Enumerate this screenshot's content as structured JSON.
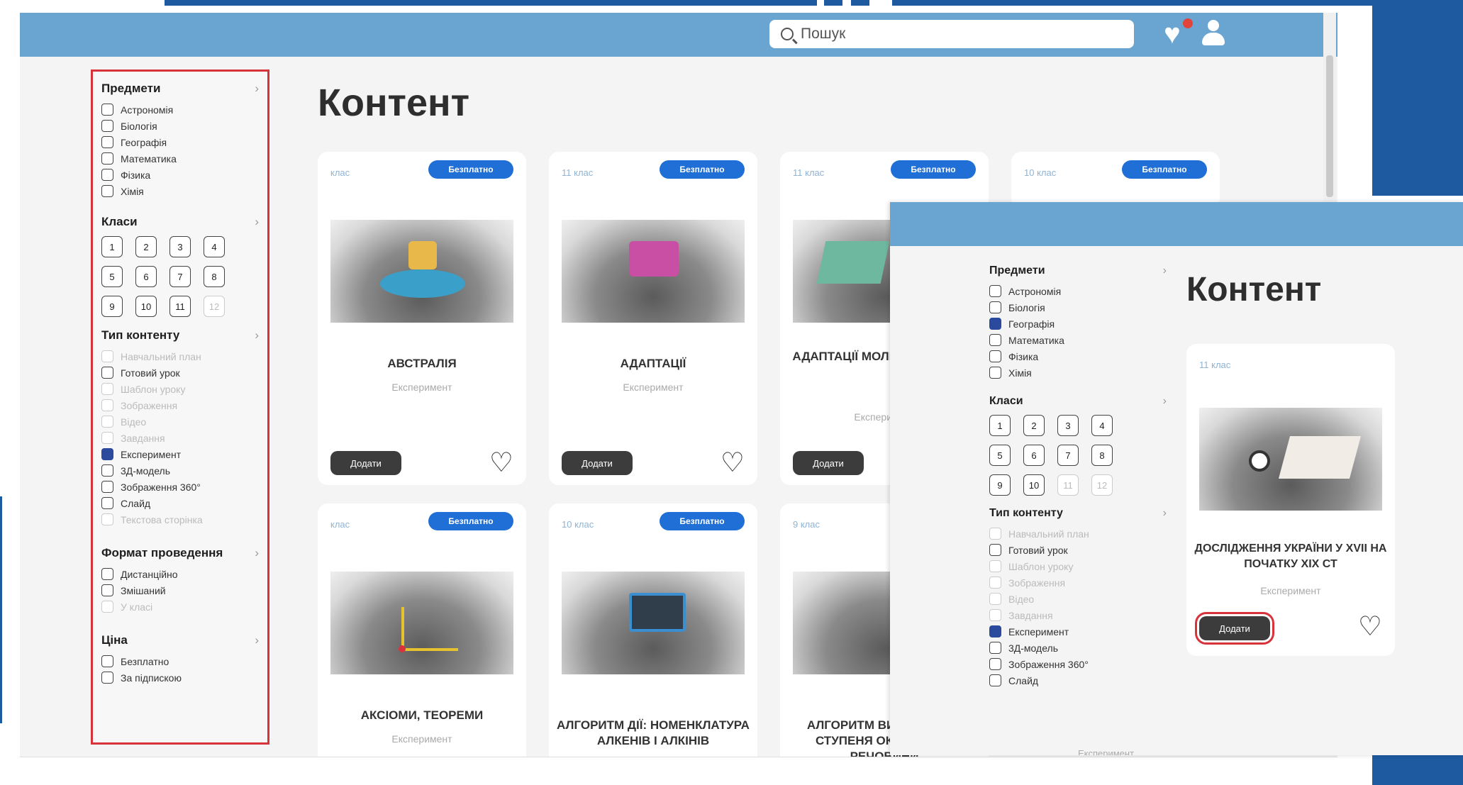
{
  "search": {
    "placeholder": "Пошук"
  },
  "page_title": "Контент",
  "sidebar": {
    "subjects": {
      "title": "Предмети",
      "items": [
        {
          "label": "Астрономія",
          "checked": false,
          "disabled": false
        },
        {
          "label": "Біологія",
          "checked": false,
          "disabled": false
        },
        {
          "label": "Географія",
          "checked": false,
          "disabled": false
        },
        {
          "label": "Математика",
          "checked": false,
          "disabled": false
        },
        {
          "label": "Фізика",
          "checked": false,
          "disabled": false
        },
        {
          "label": "Хімія",
          "checked": false,
          "disabled": false
        }
      ]
    },
    "grades": {
      "title": "Класи",
      "items": [
        "1",
        "2",
        "3",
        "4",
        "5",
        "6",
        "7",
        "8",
        "9",
        "10",
        "11",
        "12"
      ]
    },
    "content_type": {
      "title": "Тип контенту",
      "items": [
        {
          "label": "Навчальний план",
          "checked": false,
          "disabled": true
        },
        {
          "label": "Готовий урок",
          "checked": false,
          "disabled": false
        },
        {
          "label": "Шаблон уроку",
          "checked": false,
          "disabled": true
        },
        {
          "label": "Зображення",
          "checked": false,
          "disabled": true
        },
        {
          "label": "Відео",
          "checked": false,
          "disabled": true
        },
        {
          "label": "Завдання",
          "checked": false,
          "disabled": true
        },
        {
          "label": "Експеримент",
          "checked": true,
          "disabled": false
        },
        {
          "label": "3Д-модель",
          "checked": false,
          "disabled": false
        },
        {
          "label": "Зображення 360°",
          "checked": false,
          "disabled": false
        },
        {
          "label": "Слайд",
          "checked": false,
          "disabled": false
        },
        {
          "label": "Текстова сторінка",
          "checked": false,
          "disabled": true
        }
      ]
    },
    "format": {
      "title": "Формат проведення",
      "items": [
        {
          "label": "Дистанційно",
          "checked": false,
          "disabled": false
        },
        {
          "label": "Змішаний",
          "checked": false,
          "disabled": false
        },
        {
          "label": "У класі",
          "checked": false,
          "disabled": true
        }
      ]
    },
    "price": {
      "title": "Ціна",
      "items": [
        {
          "label": "Безплатно",
          "checked": false,
          "disabled": false
        },
        {
          "label": "За підпискою",
          "checked": false,
          "disabled": false
        }
      ]
    }
  },
  "cards": [
    {
      "grade": "клас",
      "badge": "Безплатно",
      "name": "АВСТРАЛІЯ",
      "kind": "Експеримент",
      "add": "Додати"
    },
    {
      "grade": "11 клас",
      "badge": "Безплатно",
      "name": "АДАПТАЦІЇ",
      "kind": "Експеримент",
      "add": "Додати"
    },
    {
      "grade": "11 клас",
      "badge": "Безплатно",
      "name": "АДАПТАЦІЇ МОЛЕКУЛ КЛІТИНИ",
      "kind": "Експеримент",
      "add": "Додати"
    },
    {
      "grade": "10 клас",
      "badge": "Безплатно"
    },
    {
      "grade": "клас",
      "badge": "Безплатно",
      "name": "АКСІОМИ, ТЕОРЕМИ",
      "kind": "Експеримент"
    },
    {
      "grade": "10 клас",
      "badge": "Безплатно",
      "name": "АЛГОРИТМ ДІЇ: НОМЕНКЛАТУРА АЛКЕНІВ І АЛКІНІВ"
    },
    {
      "grade": "9 клас",
      "name": "АЛГОРИТМ ВИЗНАЧЕННЯ СТУПЕНЯ ОКИСНЕННЯ РЕЧОВИНИ"
    }
  ],
  "overlay": {
    "page_title": "Контент",
    "subjects": {
      "title": "Предмети",
      "items": [
        {
          "label": "Астрономія",
          "checked": false
        },
        {
          "label": "Біологія",
          "checked": false
        },
        {
          "label": "Географія",
          "checked": true
        },
        {
          "label": "Математика",
          "checked": false
        },
        {
          "label": "Фізика",
          "checked": false
        },
        {
          "label": "Хімія",
          "checked": false
        }
      ]
    },
    "grades_title": "Класи",
    "content_type": {
      "title": "Тип контенту",
      "items": [
        {
          "label": "Навчальний план",
          "checked": false,
          "disabled": true
        },
        {
          "label": "Готовий урок",
          "checked": false,
          "disabled": false
        },
        {
          "label": "Шаблон уроку",
          "checked": false,
          "disabled": true
        },
        {
          "label": "Зображення",
          "checked": false,
          "disabled": true
        },
        {
          "label": "Відео",
          "checked": false,
          "disabled": true
        },
        {
          "label": "Завдання",
          "checked": false,
          "disabled": true
        },
        {
          "label": "Експеримент",
          "checked": true,
          "disabled": false
        },
        {
          "label": "3Д-модель",
          "checked": false,
          "disabled": false
        },
        {
          "label": "Зображення 360°",
          "checked": false,
          "disabled": false
        },
        {
          "label": "Слайд",
          "checked": false,
          "disabled": false
        }
      ]
    },
    "card": {
      "grade": "11 клас",
      "name": "ДОСЛІДЖЕННЯ УКРАЇНИ У XVII НА ПОЧАТКУ XIX СТ",
      "kind": "Експеримент",
      "add": "Додати"
    },
    "footer_kind": "Експеримент"
  },
  "colors": {
    "header": "#6aa5d2",
    "badge": "#1f6fd6",
    "highlight": "#d8323b",
    "frame": "#1e5aa0"
  }
}
